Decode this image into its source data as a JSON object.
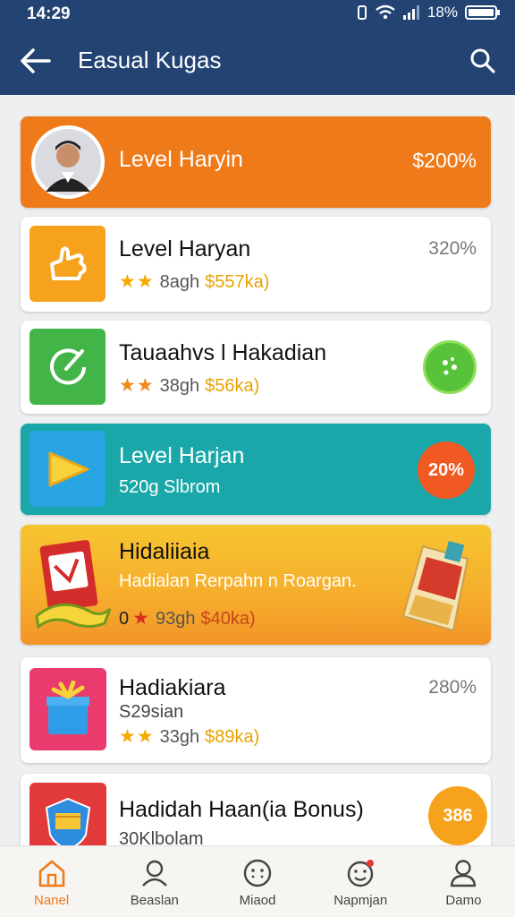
{
  "status_bar": {
    "time": "14:29",
    "battery": "18%"
  },
  "app_bar": {
    "title": "Easual Kugas"
  },
  "cards": [
    {
      "title": "Level Haryin",
      "value": "$200%"
    },
    {
      "title": "Level Haryan",
      "stars": "★★",
      "meta": "8agh",
      "price": "$557ka)",
      "value": "320%"
    },
    {
      "title": "Tauaahvs l Hakadian",
      "stars": "★★",
      "meta": "38gh",
      "price": "$56ka)"
    },
    {
      "title": "Level Harjan",
      "subtitle": "520g Slbrom",
      "badge": "20%"
    },
    {
      "title": "Hidaliiaia",
      "subtitle": "Hadialan Rerpahn n Roargan.",
      "prefix": "0",
      "stars": "★",
      "meta": "93gh",
      "price": "$40ka)"
    },
    {
      "title": "Hadiakiara",
      "subtitle": "S29sian",
      "stars": "★★",
      "meta": "33gh",
      "price": "$89ka)",
      "value": "280%"
    },
    {
      "title": "Hadidah Haan(ia Bonus)",
      "subtitle": "30Klbolam",
      "badge": "386"
    }
  ],
  "bottom_nav": [
    {
      "label": "Nanel",
      "active": true
    },
    {
      "label": "Beaslan"
    },
    {
      "label": "Miaod"
    },
    {
      "label": "Napmjan"
    },
    {
      "label": "Damo"
    }
  ],
  "colors": {
    "app_bar": "#234373",
    "orange_card": "#ef7a1a",
    "teal_card": "#1aa7a9",
    "yellow_card": "#f5b82e",
    "accent": "#ef7a1a"
  }
}
